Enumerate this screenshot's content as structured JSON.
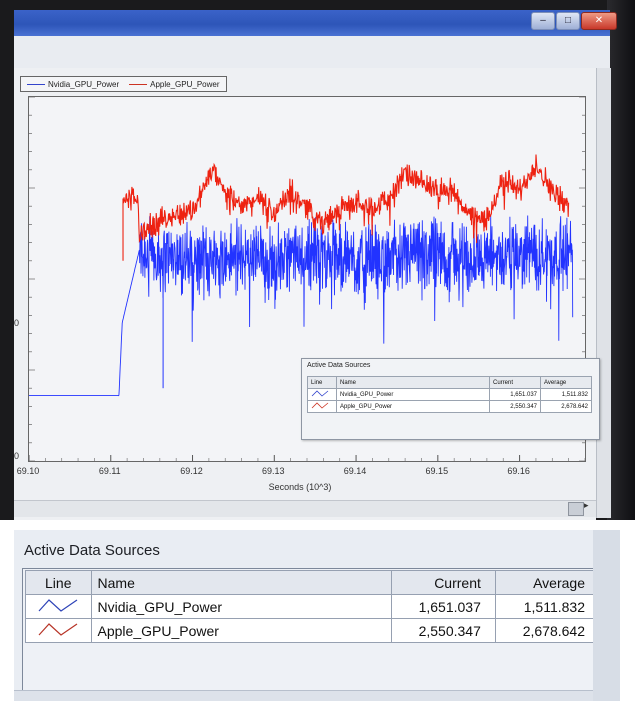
{
  "colors": {
    "nvidia_line": "#2233ff",
    "apple_line": "#ee2211",
    "titlebar": "#2d55b8"
  },
  "window": {
    "controls": [
      "minimize",
      "maximize",
      "close"
    ]
  },
  "legend": {
    "items": [
      {
        "label": "Nvidia_GPU_Power",
        "color": "#3344cc"
      },
      {
        "label": "Apple_GPU_Power",
        "color": "#cc3322"
      }
    ]
  },
  "chart_data": {
    "type": "line",
    "title": "",
    "xlabel": "Seconds (10^3)",
    "ylabel": "",
    "xlim": [
      69.1,
      69.168
    ],
    "ylim": [
      0,
      100
    ],
    "x_ticks": [
      "69.10",
      "69.11",
      "69.12",
      "69.13",
      "69.14",
      "69.15",
      "69.16"
    ],
    "y_edge_labels": [
      "0",
      "0"
    ],
    "grid": false,
    "legend_position": "top-left",
    "series": [
      {
        "name": "Nvidia_GPU_Power",
        "color": "#2233ff",
        "x": [
          69.1,
          69.111,
          69.1114,
          69.1135,
          69.116,
          69.12,
          69.125,
          69.13,
          69.135,
          69.14,
          69.145,
          69.15,
          69.155,
          69.16,
          69.1665
        ],
        "y": [
          18,
          18,
          38,
          58,
          56,
          55,
          56,
          55,
          57,
          55,
          56,
          57,
          56,
          57,
          57
        ],
        "noise_amplitude": 8
      },
      {
        "name": "Apple_GPU_Power",
        "color": "#ee2211",
        "x": [
          69.1115,
          69.1117,
          69.1133,
          69.1135,
          69.116,
          69.12,
          69.1225,
          69.124,
          69.126,
          69.128,
          69.13,
          69.132,
          69.134,
          69.136,
          69.138,
          69.14,
          69.142,
          69.144,
          69.146,
          69.148,
          69.15,
          69.152,
          69.154,
          69.156,
          69.158,
          69.16,
          69.162,
          69.164,
          69.166
        ],
        "y": [
          72,
          72,
          72,
          62,
          66,
          69,
          80,
          73,
          70,
          72,
          68,
          74,
          70,
          65,
          69,
          71,
          70,
          72,
          79,
          76,
          75,
          74,
          67,
          66,
          78,
          74,
          82,
          74,
          70
        ],
        "noise_amplitude": 3
      }
    ]
  },
  "small_panel": {
    "title": "Active Data Sources",
    "headers": [
      "Line",
      "Name",
      "Current",
      "Average"
    ],
    "rows": [
      {
        "name": "Nvidia_GPU_Power",
        "current": "1,651.037",
        "average": "1,511.832"
      },
      {
        "name": "Apple_GPU_Power",
        "current": "2,550.347",
        "average": "2,678.642"
      }
    ]
  },
  "big_panel": {
    "title": "Active Data Sources",
    "headers": [
      "Line",
      "Name",
      "Current",
      "Average"
    ],
    "rows": [
      {
        "name": "Nvidia_GPU_Power",
        "current": "1,651.037",
        "average": "1,511.832"
      },
      {
        "name": "Apple_GPU_Power",
        "current": "2,550.347",
        "average": "2,678.642"
      }
    ]
  }
}
